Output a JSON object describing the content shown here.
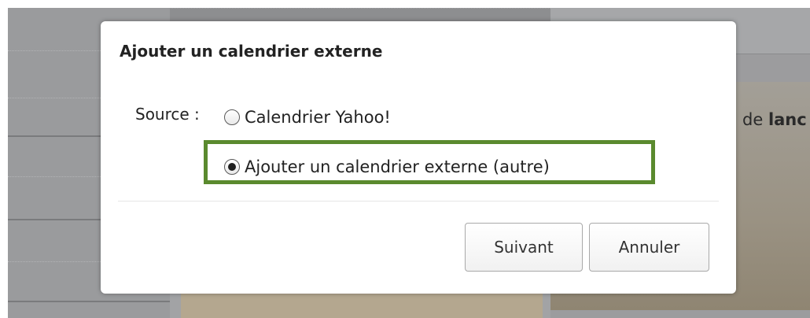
{
  "background": {
    "right_text_prefix": "de ",
    "right_text_bold": "lanc"
  },
  "dialog": {
    "title": "Ajouter un calendrier externe",
    "source_label": "Source :",
    "options": [
      {
        "label": "Calendrier Yahoo!",
        "checked": false
      },
      {
        "label": "Ajouter un calendrier externe (autre)",
        "checked": true
      }
    ],
    "buttons": {
      "next_label": "Suivant",
      "cancel_label": "Annuler"
    }
  },
  "colors": {
    "highlight": "#5a8a2e",
    "overlay": "#8d8e90",
    "dialog_bg": "#ffffff"
  },
  "icons": [
    "radio-unchecked-icon",
    "radio-checked-icon"
  ]
}
